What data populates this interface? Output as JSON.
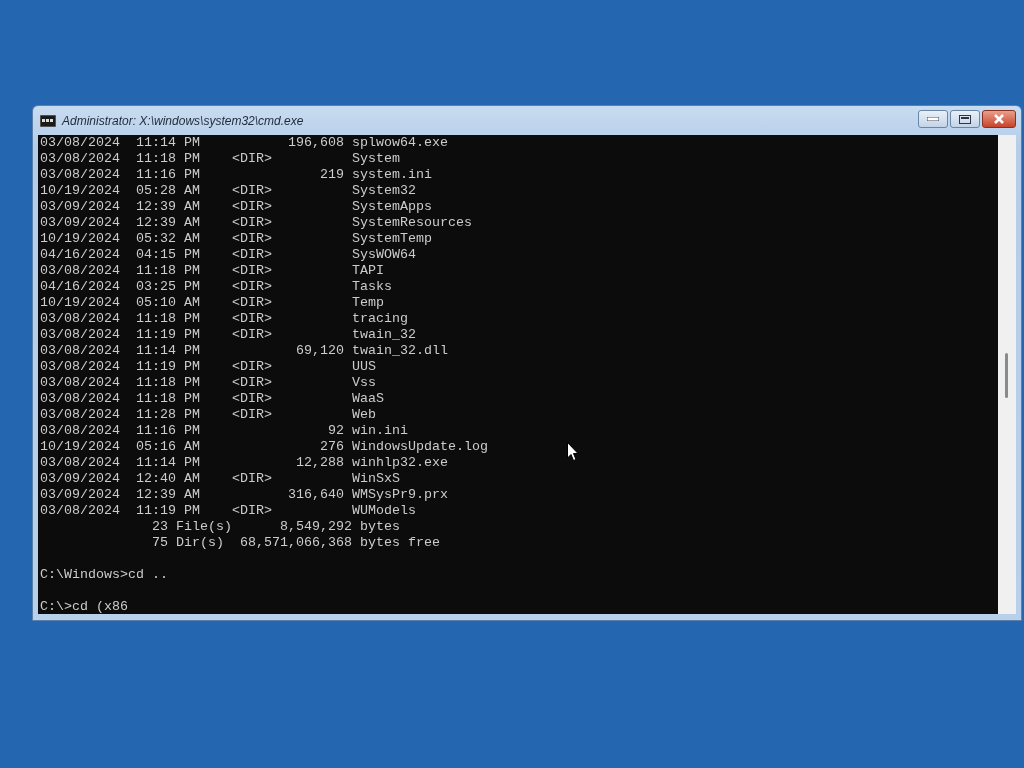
{
  "window": {
    "title": "Administrator: X:\\windows\\system32\\cmd.exe"
  },
  "console": {
    "lines": [
      {
        "text": "03/08/2024  11:14 PM           196,608 splwow64.exe",
        "blank_before": false
      },
      {
        "text": "03/08/2024  11:18 PM    <DIR>          System",
        "blank_before": false
      },
      {
        "text": "03/08/2024  11:16 PM               219 system.ini",
        "blank_before": false
      },
      {
        "text": "10/19/2024  05:28 AM    <DIR>          System32",
        "blank_before": false
      },
      {
        "text": "03/09/2024  12:39 AM    <DIR>          SystemApps",
        "blank_before": false
      },
      {
        "text": "03/09/2024  12:39 AM    <DIR>          SystemResources",
        "blank_before": false
      },
      {
        "text": "10/19/2024  05:32 AM    <DIR>          SystemTemp",
        "blank_before": false
      },
      {
        "text": "04/16/2024  04:15 PM    <DIR>          SysWOW64",
        "blank_before": false
      },
      {
        "text": "03/08/2024  11:18 PM    <DIR>          TAPI",
        "blank_before": false
      },
      {
        "text": "04/16/2024  03:25 PM    <DIR>          Tasks",
        "blank_before": false
      },
      {
        "text": "10/19/2024  05:10 AM    <DIR>          Temp",
        "blank_before": false
      },
      {
        "text": "03/08/2024  11:18 PM    <DIR>          tracing",
        "blank_before": false
      },
      {
        "text": "03/08/2024  11:19 PM    <DIR>          twain_32",
        "blank_before": false
      },
      {
        "text": "03/08/2024  11:14 PM            69,120 twain_32.dll",
        "blank_before": false
      },
      {
        "text": "03/08/2024  11:19 PM    <DIR>          UUS",
        "blank_before": false
      },
      {
        "text": "03/08/2024  11:18 PM    <DIR>          Vss",
        "blank_before": false
      },
      {
        "text": "03/08/2024  11:18 PM    <DIR>          WaaS",
        "blank_before": false
      },
      {
        "text": "03/08/2024  11:28 PM    <DIR>          Web",
        "blank_before": false
      },
      {
        "text": "03/08/2024  11:16 PM                92 win.ini",
        "blank_before": false
      },
      {
        "text": "10/19/2024  05:16 AM               276 WindowsUpdate.log",
        "blank_before": false
      },
      {
        "text": "03/08/2024  11:14 PM            12,288 winhlp32.exe",
        "blank_before": false
      },
      {
        "text": "03/09/2024  12:40 AM    <DIR>          WinSxS",
        "blank_before": false
      },
      {
        "text": "03/09/2024  12:39 AM           316,640 WMSysPr9.prx",
        "blank_before": false
      },
      {
        "text": "03/08/2024  11:19 PM    <DIR>          WUModels",
        "blank_before": false
      },
      {
        "text": "              23 File(s)      8,549,292 bytes",
        "blank_before": false
      },
      {
        "text": "              75 Dir(s)  68,571,066,368 bytes free",
        "blank_before": false
      },
      {
        "text": "C:\\Windows>cd ..",
        "blank_before": true
      },
      {
        "text": "C:\\>cd (x86",
        "blank_before": true
      }
    ]
  }
}
